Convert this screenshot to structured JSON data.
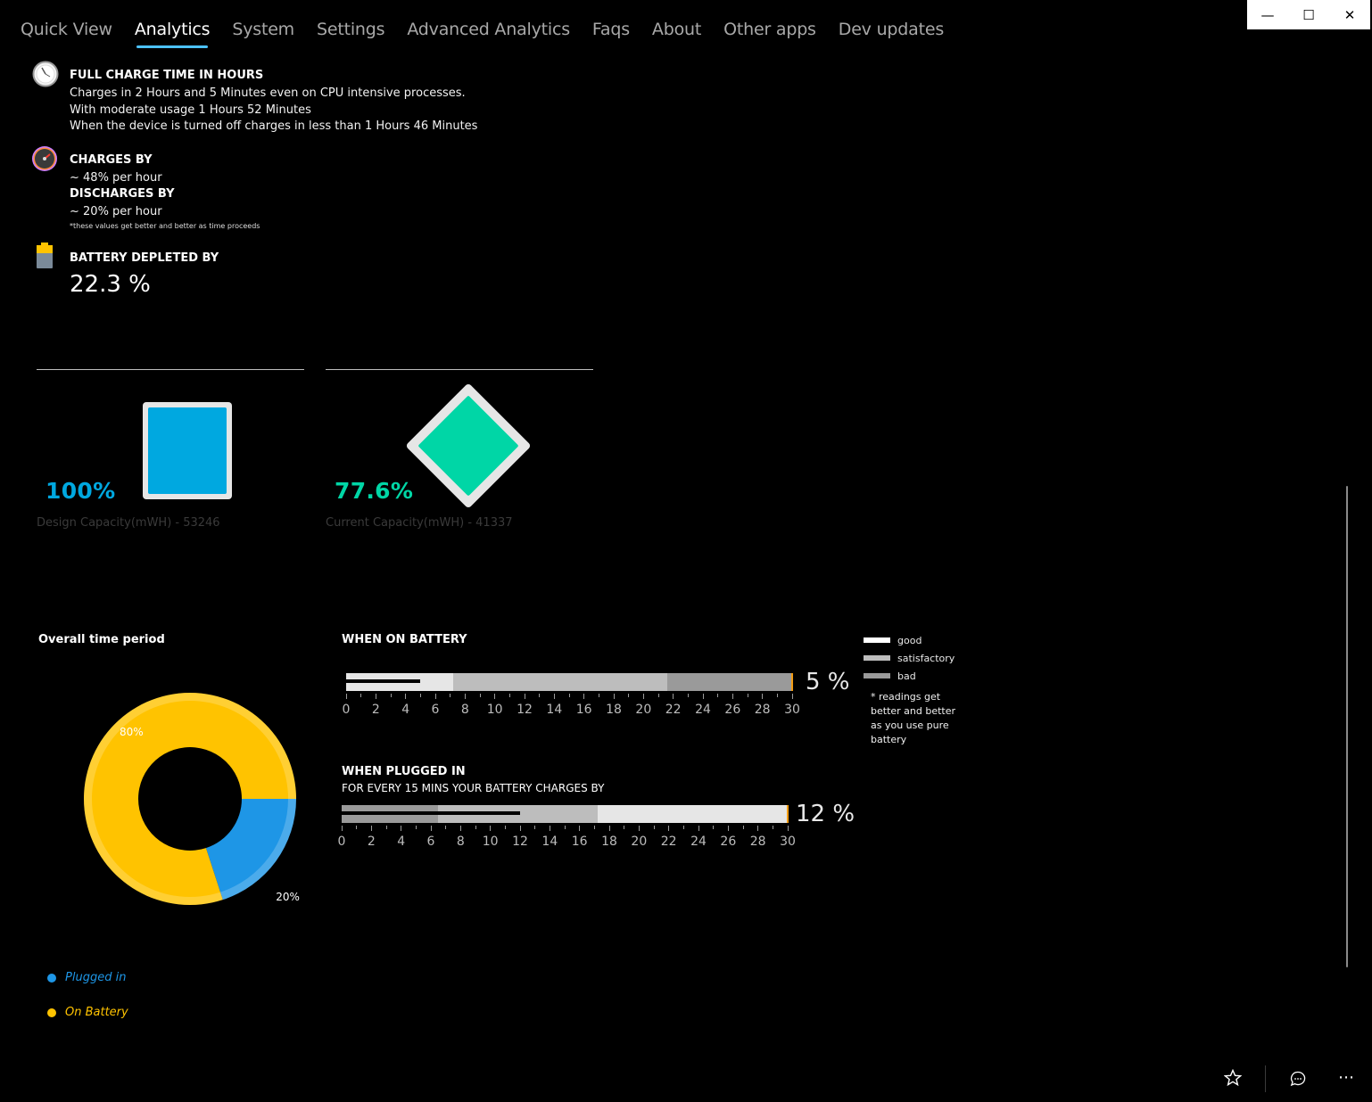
{
  "window": {
    "minimize_glyph": "—",
    "maximize_glyph": "☐",
    "close_glyph": "✕"
  },
  "nav": {
    "tabs": [
      {
        "label": "Quick View"
      },
      {
        "label": "Analytics"
      },
      {
        "label": "System"
      },
      {
        "label": "Settings"
      },
      {
        "label": "Advanced Analytics"
      },
      {
        "label": "Faqs"
      },
      {
        "label": "About"
      },
      {
        "label": "Other apps"
      },
      {
        "label": "Dev updates"
      }
    ],
    "active_index": 1
  },
  "full_charge": {
    "icon": "clock-icon",
    "title": "FULL CHARGE TIME IN HOURS",
    "line1": "Charges in 2 Hours and 5 Minutes even on CPU intensive processes.",
    "line2": "With moderate usage 1 Hours 52 Minutes",
    "line3": "When the device is turned off charges in less than 1 Hours 46 Minutes"
  },
  "rates": {
    "icon": "speedometer-icon",
    "charges_title": "CHARGES  BY",
    "charges_value": "~ 48% per hour",
    "discharges_title": "DISCHARGES  BY",
    "discharges_value": "~ 20% per hour",
    "note": "*these values get better and better as time proceeds"
  },
  "depleted": {
    "icon": "battery-icon",
    "title": "BATTERY DEPLETED BY",
    "value": "22.3 %"
  },
  "capacity": {
    "design": {
      "percent": "100%",
      "label": "Design Capacity(mWH) - 53246",
      "color": "#00a8e0",
      "fill": 1.0
    },
    "current": {
      "percent": "77.6%",
      "label": "Current Capacity(mWH) - 41337",
      "color": "#00d6a6",
      "fill": 0.776
    }
  },
  "overall": {
    "title": "Overall time period",
    "chart_data": {
      "type": "pie",
      "categories": [
        "Plugged in",
        "On Battery"
      ],
      "values": [
        20,
        80
      ],
      "data_labels": [
        "20%",
        "80%"
      ],
      "colors": [
        "#1e96e6",
        "#ffc300"
      ],
      "legend_position": "bottom-left"
    },
    "legend": [
      {
        "label": "Plugged in",
        "color": "#1e96e6"
      },
      {
        "label": "On Battery",
        "color": "#ffc300"
      }
    ]
  },
  "on_battery": {
    "title": "WHEN ON BATTERY",
    "value_label": "5 %",
    "chart_data": {
      "type": "bar",
      "ranges": [
        {
          "name": "good",
          "from": 0,
          "to": 7.2
        },
        {
          "name": "satisfactory",
          "from": 7.2,
          "to": 21.6
        },
        {
          "name": "bad",
          "from": 21.6,
          "to": 30
        }
      ],
      "value": 5,
      "xlim": [
        0,
        30
      ],
      "ticks": [
        "0",
        "2",
        "4",
        "6",
        "8",
        "10",
        "12",
        "14",
        "16",
        "18",
        "20",
        "22",
        "24",
        "26",
        "28",
        "30"
      ]
    }
  },
  "plugged_in": {
    "title": "WHEN PLUGGED IN",
    "subtitle": "FOR EVERY 15 MINS YOUR BATTERY CHARGES BY",
    "value_label": "12 %",
    "chart_data": {
      "type": "bar",
      "ranges": [
        {
          "name": "bad",
          "from": 0,
          "to": 6.5
        },
        {
          "name": "satisfactory",
          "from": 6.5,
          "to": 17.2
        },
        {
          "name": "good",
          "from": 17.2,
          "to": 30
        }
      ],
      "value": 12,
      "xlim": [
        0,
        30
      ],
      "ticks": [
        "0",
        "2",
        "4",
        "6",
        "8",
        "10",
        "12",
        "14",
        "16",
        "18",
        "20",
        "22",
        "24",
        "26",
        "28",
        "30"
      ]
    }
  },
  "key": {
    "items": [
      {
        "label": "good",
        "color": "#ffffff"
      },
      {
        "label": "satisfactory",
        "color": "#bdbdbd"
      },
      {
        "label": "bad",
        "color": "#9a9a9a"
      }
    ],
    "note": "* readings get better and better as you use pure battery"
  },
  "colors": {
    "good": "#e6e6e6",
    "satisfactory": "#bdbdbd",
    "bad": "#9a9a9a",
    "marker": "#f39c12"
  },
  "footer": {
    "favorite_icon": "star-icon",
    "feedback_icon": "chat-icon",
    "more_icon": "more-icon"
  }
}
